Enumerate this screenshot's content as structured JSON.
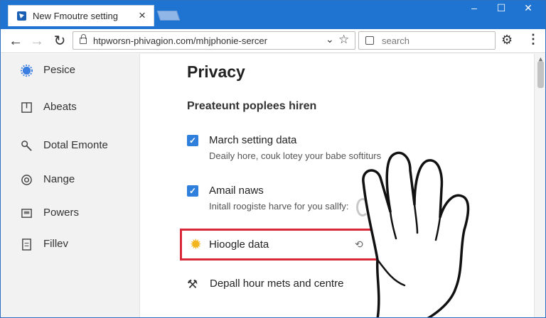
{
  "browser": {
    "tab_title": "New Fmoutre setting",
    "tab_close": "×",
    "window_controls": {
      "minimize": "–",
      "maximize": "☐",
      "close": "✕"
    },
    "url": "htpworsn-phivagion.com/mhjphonie-sercer",
    "search_placeholder": "search"
  },
  "sidebar": {
    "items": [
      {
        "label": "Pesice",
        "icon": "gear-icon"
      },
      {
        "label": "Abeats",
        "icon": "page-icon"
      },
      {
        "label": "Dotal Emonte",
        "icon": "key-icon"
      },
      {
        "label": "Nange",
        "icon": "globe-icon"
      },
      {
        "label": "Powers",
        "icon": "drive-icon"
      },
      {
        "label": "Fillev",
        "icon": "document-icon"
      }
    ]
  },
  "main": {
    "title": "Privacy",
    "section_title": "Preateunt poplees hiren",
    "settings": [
      {
        "title": "March setting data",
        "description": "Deaily hore, couk lotey your babe softiturs",
        "checked": true
      },
      {
        "title": "Amail naws",
        "description": "Initall roogiste harve for you sallfy:",
        "checked": true
      }
    ],
    "highlighted_item": {
      "label": "Hioogle data",
      "icon": "sun-icon"
    },
    "last_item": {
      "label": "Depall hour mets and centre",
      "icon": "tools-icon"
    }
  },
  "colors": {
    "titlebar": "#1f73d1",
    "checkbox": "#2f7fdc",
    "highlight_border": "#d8283a"
  }
}
